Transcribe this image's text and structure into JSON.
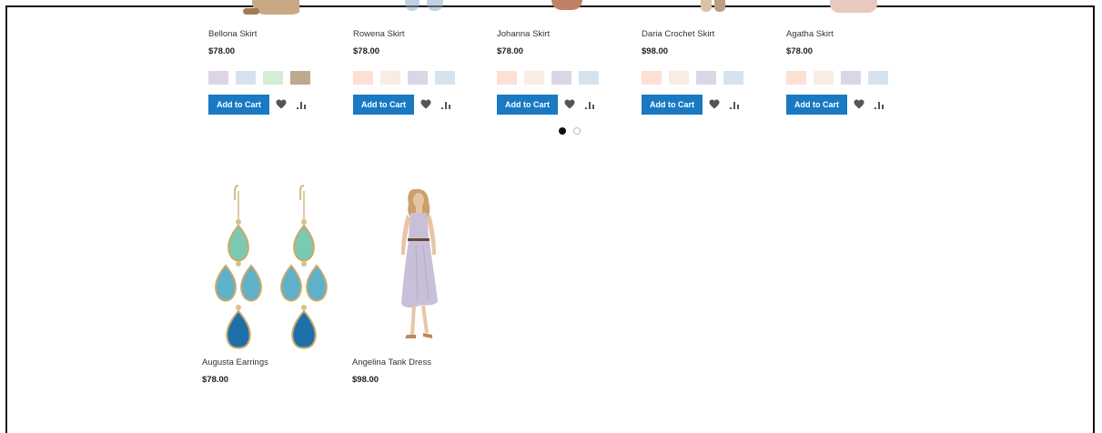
{
  "top_row": [
    {
      "name": "Bellona Skirt",
      "price": "$78.00",
      "swatches": [
        "#dcd5e6",
        "#d6e3ef",
        "#d3edd6",
        "#bfa98c"
      ],
      "add_to_cart": "Add to Cart"
    },
    {
      "name": "Rowena Skirt",
      "price": "$78.00",
      "swatches": [
        "#fde0d4",
        "#f8ede4",
        "#dcd5e6",
        "#d6e3ef"
      ],
      "add_to_cart": "Add to Cart"
    },
    {
      "name": "Johanna Skirt",
      "price": "$78.00",
      "swatches": [
        "#fde0d4",
        "#f8ede4",
        "#dcd5e6",
        "#d6e3ef"
      ],
      "add_to_cart": "Add to Cart"
    },
    {
      "name": "Daria Crochet Skirt",
      "price": "$98.00",
      "swatches": [
        "#fde0d4",
        "#f8ede4",
        "#dcd5e6",
        "#d6e3ef"
      ],
      "add_to_cart": "Add to Cart"
    },
    {
      "name": "Agatha Skirt",
      "price": "$78.00",
      "swatches": [
        "#fde0d4",
        "#f8ede4",
        "#dcd5e6",
        "#d6e3ef"
      ],
      "add_to_cart": "Add to Cart"
    }
  ],
  "carousel": {
    "pages": 2,
    "active_page": 1
  },
  "bottom_row": [
    {
      "name": "Augusta Earrings",
      "price": "$78.00",
      "image": "teal-drop-earrings"
    },
    {
      "name": "Angelina Tank Dress",
      "price": "$98.00",
      "image": "lavender-tank-dress"
    }
  ],
  "colors": {
    "accent": "#1979c3",
    "icon": "#555555"
  }
}
